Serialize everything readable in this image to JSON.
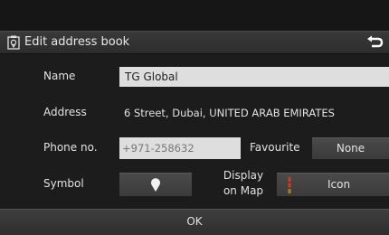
{
  "header": {
    "title": "Edit address book"
  },
  "fields": {
    "name_label": "Name",
    "name_value": "TG Global",
    "address_label": "Address",
    "address_value": "6 Street, Dubai, UNITED ARAB EMIRATES",
    "phone_label": "Phone no.",
    "phone_value": "+971-258632",
    "favourite_label": "Favourite",
    "favourite_value": "None",
    "symbol_label": "Symbol",
    "display_label_line1": "Display",
    "display_label_line2": "on Map",
    "display_value": "Icon"
  },
  "footer": {
    "ok_label": "OK"
  },
  "icons": {
    "header_icon": "address-book-pin-icon",
    "back_icon": "back-arrow-icon",
    "symbol_icon": "map-pin-icon",
    "display_marker": "marker-icon"
  },
  "colors": {
    "accent_marker": "#d23a1a",
    "field_bg": "#dedede"
  }
}
